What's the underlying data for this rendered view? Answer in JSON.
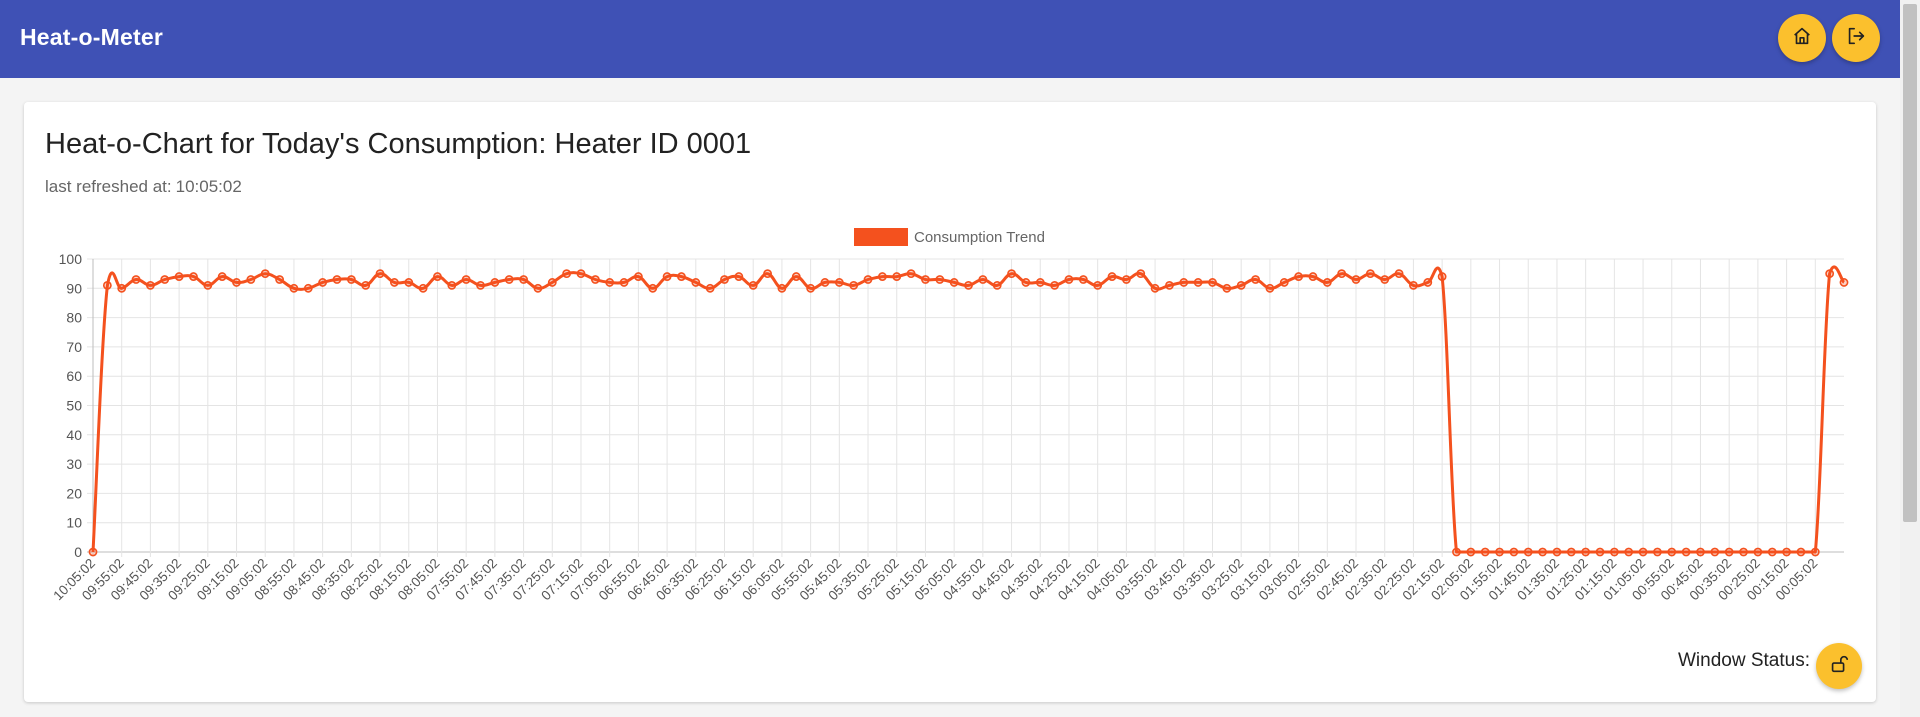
{
  "app": {
    "title": "Heat-o-Meter"
  },
  "header": {
    "home_icon": "home-icon",
    "logout_icon": "logout-icon"
  },
  "card": {
    "title": "Heat-o-Chart for Today's Consumption: Heater ID 0001",
    "refreshed_label": "last refreshed at:",
    "refreshed_time": "10:05:02",
    "window_status_label": "Window Status:",
    "window_status_icon": "unlock-icon"
  },
  "colors": {
    "header": "#3f51b5",
    "accent": "#fbc02d",
    "series": "#f4511e"
  },
  "chart_data": {
    "type": "line",
    "title": "",
    "xlabel": "",
    "ylabel": "",
    "ylim": [
      0,
      100
    ],
    "yticks": [
      0,
      10,
      20,
      30,
      40,
      50,
      60,
      70,
      80,
      90,
      100
    ],
    "grid": true,
    "legend_position": "top",
    "x_tick_labels": [
      "10:05:02",
      "09:55:02",
      "09:45:02",
      "09:35:02",
      "09:25:02",
      "09:15:02",
      "09:05:02",
      "08:55:02",
      "08:45:02",
      "08:35:02",
      "08:25:02",
      "08:15:02",
      "08:05:02",
      "07:55:02",
      "07:45:02",
      "07:35:02",
      "07:25:02",
      "07:15:02",
      "07:05:02",
      "06:55:02",
      "06:45:02",
      "06:35:02",
      "06:25:02",
      "06:15:02",
      "06:05:02",
      "05:55:02",
      "05:45:02",
      "05:35:02",
      "05:25:02",
      "05:15:02",
      "05:05:02",
      "04:55:02",
      "04:45:02",
      "04:35:02",
      "04:25:02",
      "04:15:02",
      "04:05:02",
      "03:55:02",
      "03:45:02",
      "03:35:02",
      "03:25:02",
      "03:15:02",
      "03:05:02",
      "02:55:02",
      "02:45:02",
      "02:35:02",
      "02:25:02",
      "02:15:02",
      "02:05:02",
      "01:55:02",
      "01:45:02",
      "01:35:02",
      "01:25:02",
      "01:15:02",
      "01:05:02",
      "00:55:02",
      "00:45:02",
      "00:35:02",
      "00:25:02",
      "00:15:02",
      "00:05:02"
    ],
    "series": [
      {
        "name": "Consumption Trend",
        "color": "#f4511e",
        "values": [
          0,
          91,
          90,
          93,
          91,
          93,
          94,
          94,
          91,
          94,
          92,
          93,
          95,
          93,
          90,
          90,
          92,
          93,
          93,
          91,
          95,
          92,
          92,
          90,
          94,
          91,
          93,
          91,
          92,
          93,
          93,
          90,
          92,
          95,
          95,
          93,
          92,
          92,
          94,
          90,
          94,
          94,
          92,
          90,
          93,
          94,
          91,
          95,
          90,
          94,
          90,
          92,
          92,
          91,
          93,
          94,
          94,
          95,
          93,
          93,
          92,
          91,
          93,
          91,
          95,
          92,
          92,
          91,
          93,
          93,
          91,
          94,
          93,
          95,
          90,
          91,
          92,
          92,
          92,
          90,
          91,
          93,
          90,
          92,
          94,
          94,
          92,
          95,
          93,
          95,
          93,
          95,
          91,
          92,
          94,
          0,
          0,
          0,
          0,
          0,
          0,
          0,
          0,
          0,
          0,
          0,
          0,
          0,
          0,
          0,
          0,
          0,
          0,
          0,
          0,
          0,
          0,
          0,
          0,
          0,
          0,
          95,
          92
        ]
      }
    ]
  }
}
